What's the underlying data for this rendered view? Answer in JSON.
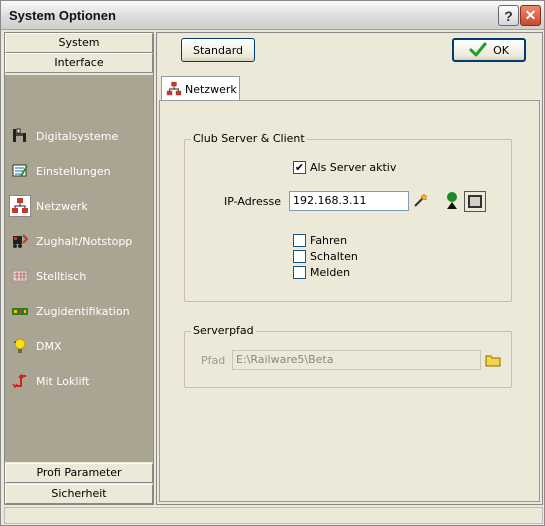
{
  "window": {
    "title": "System Optionen"
  },
  "titlebar": {
    "help_label": "?",
    "close_label": "✕"
  },
  "sidebar": {
    "top_headers": [
      "System",
      "Interface"
    ],
    "items": [
      {
        "label": "Digitalsysteme",
        "icon": "locomotive-icon"
      },
      {
        "label": "Einstellungen",
        "icon": "settings-icon"
      },
      {
        "label": "Netzwerk",
        "icon": "network-icon",
        "selected": true
      },
      {
        "label": "Zughalt/Notstopp",
        "icon": "emergency-stop-icon"
      },
      {
        "label": "Stelltisch",
        "icon": "control-panel-icon"
      },
      {
        "label": "Zugidentifikation",
        "icon": "train-id-icon"
      },
      {
        "label": "DMX",
        "icon": "lightbulb-icon"
      },
      {
        "label": "Mit Loklift",
        "icon": "loklift-icon"
      }
    ],
    "bottom_headers": [
      "Profi Parameter",
      "Sicherheit"
    ]
  },
  "toolbar": {
    "standard_label": "Standard",
    "ok_label": "OK"
  },
  "tab": {
    "label": "Netzwerk"
  },
  "club_server": {
    "legend": "Club Server & Client",
    "server_checkbox": {
      "label": "Als Server aktiv",
      "checked": true
    },
    "ip_label": "IP-Adresse",
    "ip_value": "192.168.3.11",
    "options": [
      {
        "label": "Fahren",
        "checked": false
      },
      {
        "label": "Schalten",
        "checked": false
      },
      {
        "label": "Melden",
        "checked": false
      }
    ]
  },
  "serverpfad": {
    "legend": "Serverpfad",
    "path_label": "Pfad",
    "path_value": "E:\\Railware5\\Beta"
  },
  "colors": {
    "sidebar_bg": "#aaa593",
    "window_bg": "#ece9d8",
    "ok_check": "#1e9e2a"
  }
}
